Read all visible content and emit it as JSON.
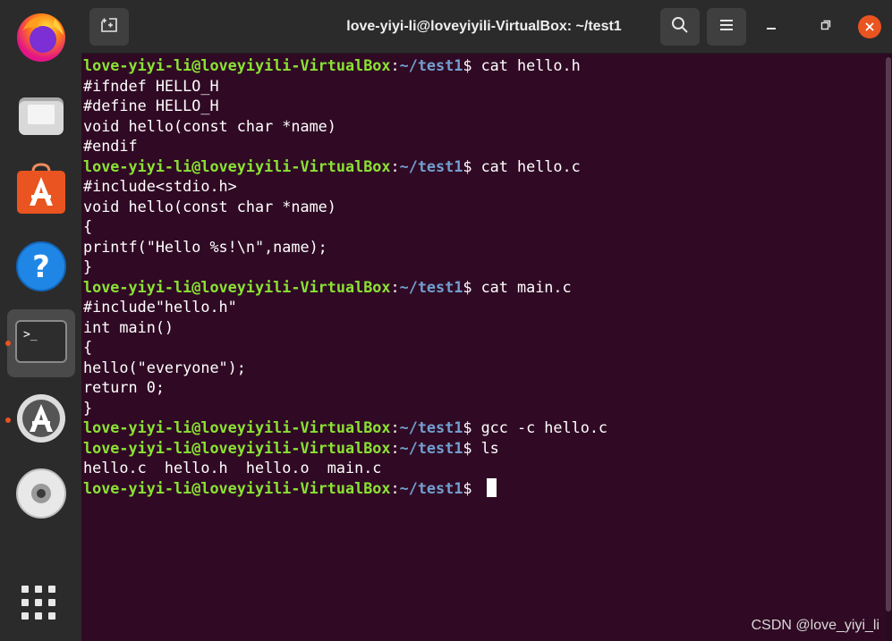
{
  "window": {
    "title": "love-yiyi-li@loveyiyili-VirtualBox: ~/test1"
  },
  "titlebar_icons": {
    "new_tab": "new-tab-icon",
    "search": "search-icon",
    "menu": "hamburger-menu-icon",
    "minimize": "minimize-icon",
    "maximize": "maximize-icon",
    "close": "close-icon"
  },
  "dock": {
    "items": [
      {
        "name": "Firefox",
        "icon": "firefox-icon",
        "running": false
      },
      {
        "name": "Files",
        "icon": "files-icon",
        "running": false
      },
      {
        "name": "Ubuntu Software",
        "icon": "software-store-icon",
        "running": false
      },
      {
        "name": "Help",
        "icon": "help-icon",
        "running": false
      },
      {
        "name": "Terminal",
        "icon": "terminal-icon",
        "running": true,
        "active": true
      },
      {
        "name": "Software Updater",
        "icon": "software-updater-icon",
        "running": true
      },
      {
        "name": "DVD",
        "icon": "disc-icon",
        "running": false
      }
    ],
    "apps_button_icon": "show-applications-icon"
  },
  "terminal": {
    "prompt_user": "love-yiyi-li@loveyiyili-VirtualBox",
    "prompt_sep": ":",
    "prompt_path": "~/test1",
    "prompt_symbol": "$ ",
    "lines": [
      {
        "type": "prompt",
        "cmd": "cat hello.h"
      },
      {
        "type": "output",
        "text": "#ifndef HELLO_H"
      },
      {
        "type": "output",
        "text": "#define HELLO_H"
      },
      {
        "type": "output",
        "text": "void hello(const char *name)"
      },
      {
        "type": "output",
        "text": "#endif"
      },
      {
        "type": "prompt",
        "cmd": "cat hello.c"
      },
      {
        "type": "output",
        "text": "#include<stdio.h>"
      },
      {
        "type": "output",
        "text": "void hello(const char *name)"
      },
      {
        "type": "output",
        "text": "{"
      },
      {
        "type": "output",
        "text": "printf(\"Hello %s!\\n\",name);"
      },
      {
        "type": "output",
        "text": "}"
      },
      {
        "type": "prompt",
        "cmd": "cat main.c"
      },
      {
        "type": "output",
        "text": "#include\"hello.h\""
      },
      {
        "type": "output",
        "text": "int main()"
      },
      {
        "type": "output",
        "text": "{"
      },
      {
        "type": "output",
        "text": "hello(\"everyone\");"
      },
      {
        "type": "output",
        "text": "return 0;"
      },
      {
        "type": "output",
        "text": "}"
      },
      {
        "type": "prompt",
        "cmd": "gcc -c hello.c"
      },
      {
        "type": "prompt",
        "cmd": "ls"
      },
      {
        "type": "output",
        "text": "hello.c  hello.h  hello.o  main.c"
      },
      {
        "type": "prompt",
        "cmd": "",
        "cursor": true
      }
    ]
  },
  "watermark": "CSDN @love_yiyi_li",
  "colors": {
    "terminal_bg": "#300a24",
    "prompt_user": "#8ae234",
    "prompt_path": "#729fcf",
    "accent": "#e95420"
  }
}
